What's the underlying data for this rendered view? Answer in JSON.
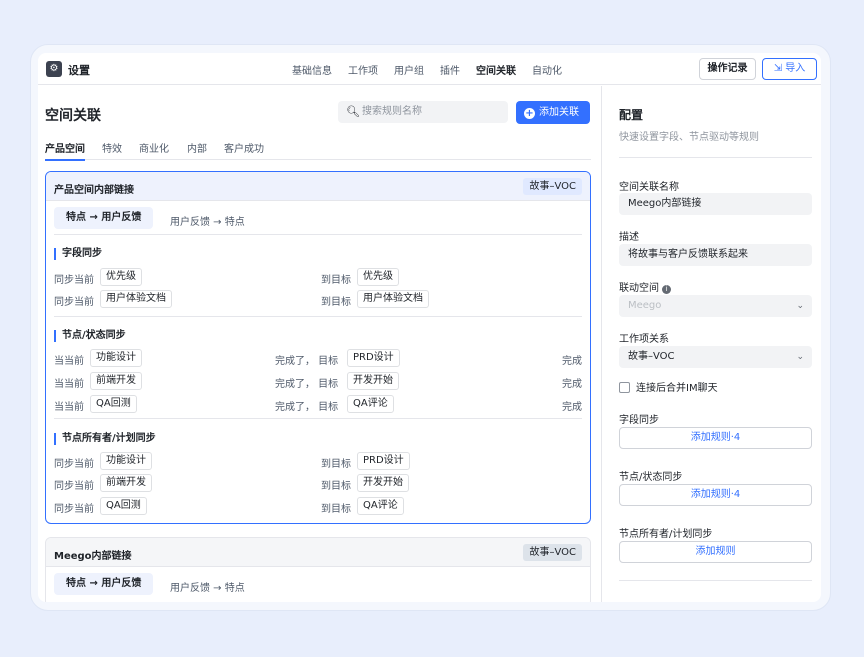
{
  "header": {
    "title": "设置",
    "nav": [
      "基础信息",
      "工作项",
      "用户组",
      "插件",
      "空间关联",
      "自动化"
    ],
    "active_nav": "空间关联",
    "log_button": "操作记录",
    "import_button": "导入"
  },
  "main": {
    "title": "空间关联",
    "search_placeholder": "搜索规则名称",
    "add_button": "添加关联",
    "tabs": [
      "产品空间",
      "特效",
      "商业化",
      "内部",
      "客户成功"
    ],
    "active_tab": "产品空间"
  },
  "card1": {
    "name": "产品空间内部链接",
    "tag": "故事–VOC",
    "path_chip": "特点 → 用户反馈",
    "path_other": "用户反馈  →  特点",
    "field_sync": {
      "title": "字段同步",
      "rows": [
        {
          "left_label": "同步当前",
          "left": "优先级",
          "right_label": "到目标",
          "right": "优先级"
        },
        {
          "left_label": "同步当前",
          "left": "用户体验文档",
          "right_label": "到目标",
          "right": "用户体验文档"
        }
      ]
    },
    "node_sync": {
      "title": "节点/状态同步",
      "rows": [
        {
          "left_label": "当当前",
          "left": "功能设计",
          "mid": "完成了，  目标",
          "right": "PRD设计",
          "end": "完成"
        },
        {
          "left_label": "当当前",
          "left": "前端开发",
          "mid": "完成了，  目标",
          "right": "开发开始",
          "end": "完成"
        },
        {
          "left_label": "当当前",
          "left": "QA回测",
          "mid": "完成了，  目标",
          "right": "QA评论",
          "end": "完成"
        }
      ]
    },
    "owner_sync": {
      "title": "节点所有者/计划同步",
      "rows": [
        {
          "left_label": "同步当前",
          "left": "功能设计",
          "right_label": "到目标",
          "right": "PRD设计"
        },
        {
          "left_label": "同步当前",
          "left": "前端开发",
          "right_label": "到目标",
          "right": "开发开始"
        },
        {
          "left_label": "同步当前",
          "left": "QA回测",
          "right_label": "到目标",
          "right": "QA评论"
        }
      ]
    }
  },
  "card2": {
    "name": "Meego内部链接",
    "tag": "故事–VOC",
    "path_chip": "特点 → 用户反馈",
    "path_other": "用户反馈  →  特点"
  },
  "config": {
    "title": "配置",
    "subtitle": "快速设置字段、节点驱动等规则",
    "name_label": "空间关联名称",
    "name_value": "Meego内部链接",
    "desc_label": "描述",
    "desc_value": "将故事与客户反馈联系起来",
    "linked_space_label": "联动空间",
    "linked_space_value": "Meego",
    "relation_label": "工作项关系",
    "relation_value": "故事–VOC",
    "checkbox_label": "连接后合并IM聊天",
    "field_sync_label": "字段同步",
    "field_sync_button": "添加规则·4",
    "node_sync_label": "节点/状态同步",
    "node_sync_button": "添加规则·4",
    "owner_sync_label": "节点所有者/计划同步",
    "owner_sync_button": "添加规则"
  }
}
